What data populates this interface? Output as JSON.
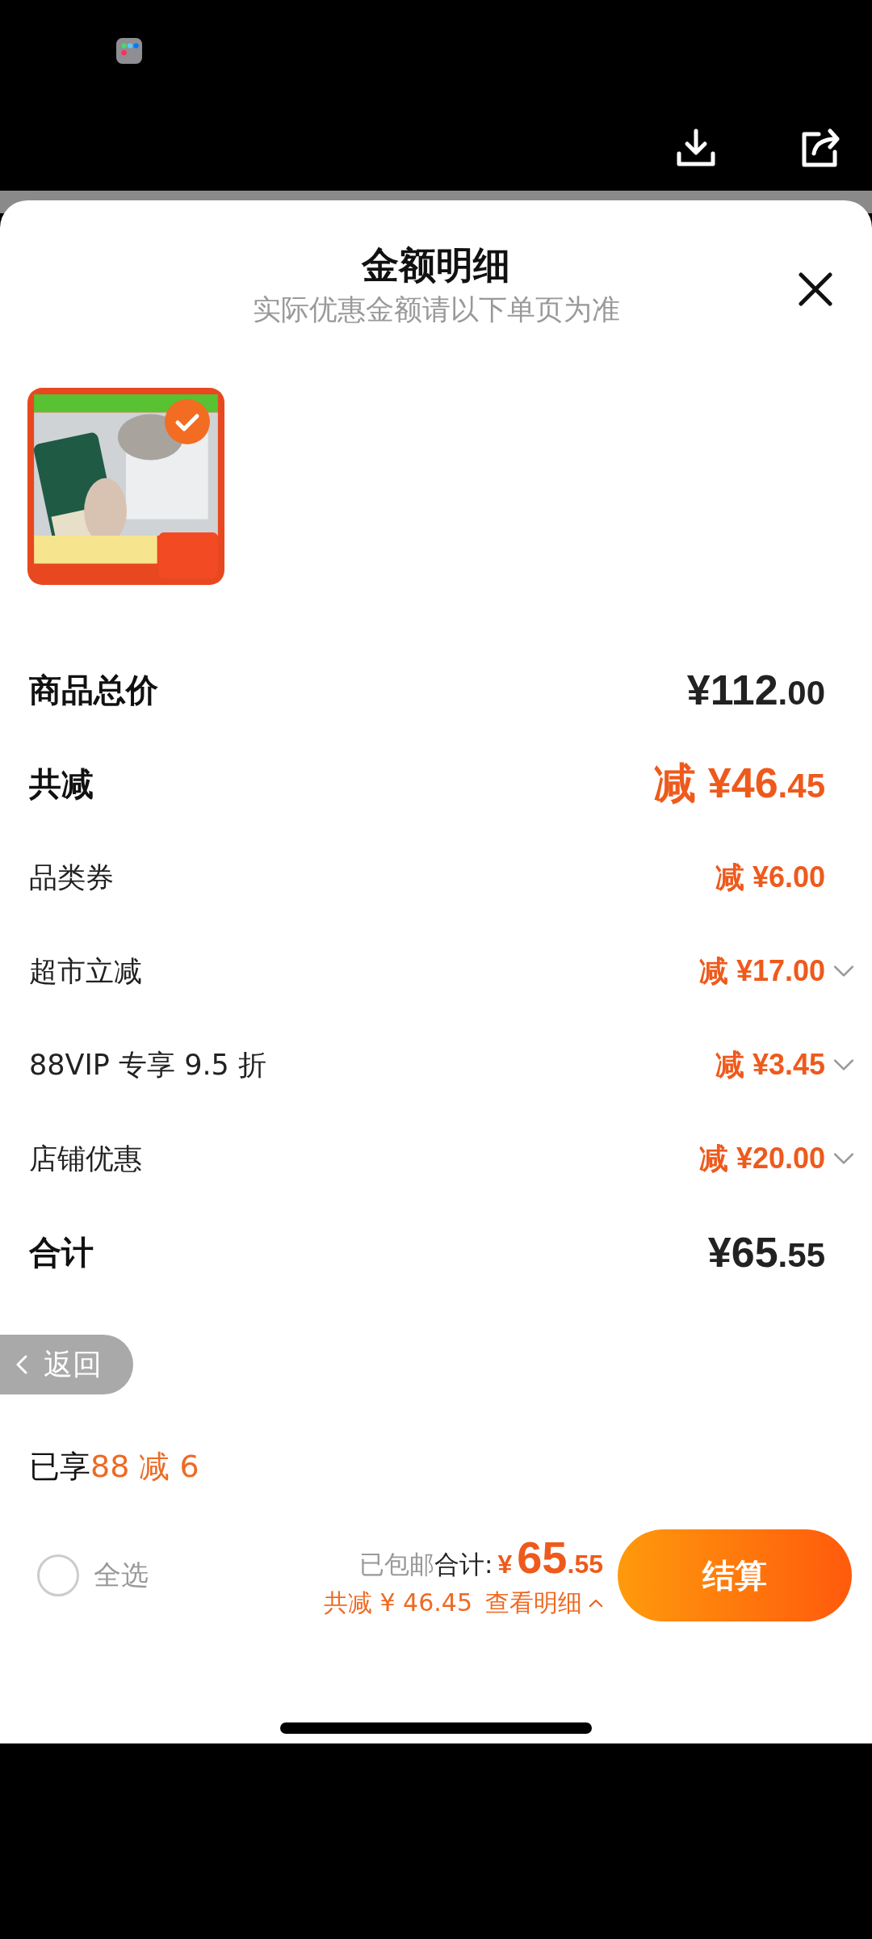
{
  "sheet": {
    "title": "金额明细",
    "subtitle": "实际优惠金额请以下单页为准"
  },
  "product": {
    "kind": "picture",
    "selected": true
  },
  "rows": [
    {
      "kind": "summary",
      "label": "商品总价",
      "discount": false,
      "prefix": "",
      "main": "¥112",
      "cents": ".00",
      "expandable": false
    },
    {
      "kind": "summary",
      "label": "共减",
      "discount": true,
      "prefix": "减",
      "main": "¥46",
      "cents": ".45",
      "expandable": false
    },
    {
      "kind": "detail",
      "label": "品类券",
      "discount": true,
      "prefix": "减",
      "main": "¥6",
      "cents": ".00",
      "expandable": false
    },
    {
      "kind": "detail",
      "label": "超市立减",
      "discount": true,
      "prefix": "减",
      "main": "¥17",
      "cents": ".00",
      "expandable": true
    },
    {
      "kind": "detail",
      "label": "88VIP 专享 9.5 折",
      "discount": true,
      "prefix": "减",
      "main": "¥3",
      "cents": ".45",
      "expandable": true
    },
    {
      "kind": "detail",
      "label": "店铺优惠",
      "discount": true,
      "prefix": "减",
      "main": "¥20",
      "cents": ".00",
      "expandable": true
    },
    {
      "kind": "summary",
      "label": "合计",
      "discount": false,
      "prefix": "",
      "main": "¥65",
      "cents": ".55",
      "expandable": false
    }
  ],
  "back_button": {
    "label": "返回"
  },
  "promo": {
    "label": "已享",
    "value": "88 减 6"
  },
  "footer": {
    "select_all": {
      "label": "全选",
      "checked": false
    },
    "shipping": "已包邮",
    "total_label": "合计:",
    "currency": "¥",
    "total_main": "65",
    "total_cents": ".55",
    "saved": "共减 ¥ 46.45",
    "details_link": "查看明细",
    "checkout": "结算"
  }
}
